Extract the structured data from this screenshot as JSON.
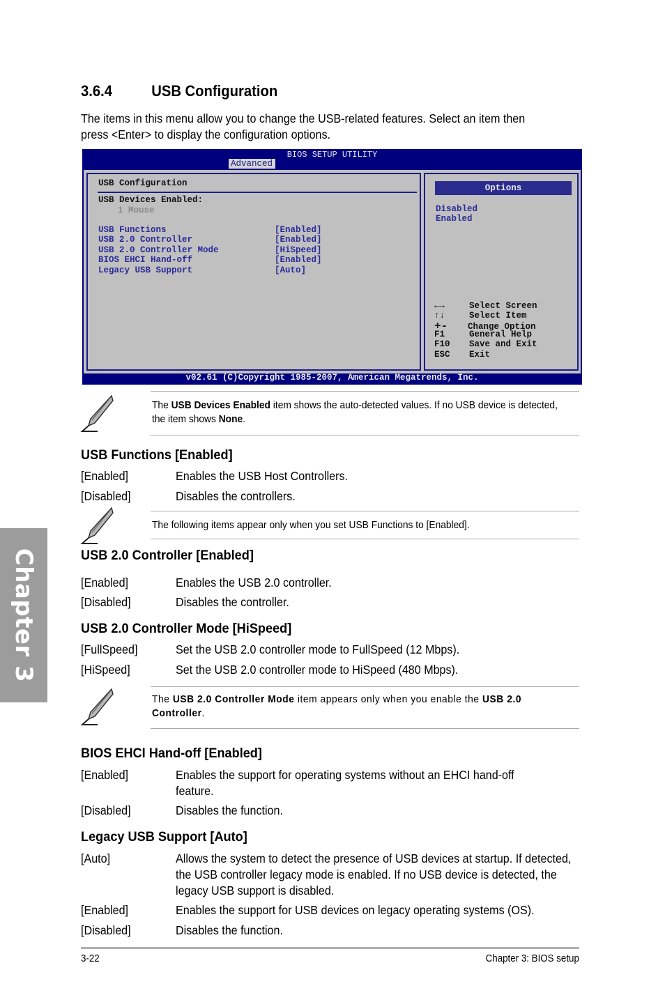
{
  "chapter_tab": "Chapter 3",
  "section": {
    "number": "3.6.4",
    "title": "USB Configuration"
  },
  "intro": [
    "The items in this menu allow you to change the USB-related features. Select an item then",
    "press <Enter> to display the configuration options."
  ],
  "bios": {
    "title": "BIOS SETUP UTILITY",
    "active_tab": "Advanced",
    "heading": "USB Configuration",
    "devices_label": "USB Devices Enabled:",
    "devices_value": "1 Mouse",
    "items": [
      {
        "label": "USB Functions",
        "value": "[Enabled]"
      },
      {
        "label": "USB 2.0 Controller",
        "value": "[Enabled]"
      },
      {
        "label": "USB 2.0 Controller Mode",
        "value": "[HiSpeed]"
      },
      {
        "label": "BIOS EHCI Hand-off",
        "value": "[Enabled]"
      },
      {
        "label": "Legacy USB Support",
        "value": "[Auto]"
      }
    ],
    "options_header": "Options",
    "options": [
      "Disabled",
      "Enabled"
    ],
    "keys": [
      {
        "key": "←→",
        "action": "Select Screen",
        "icon": "left-right-arrows-icon"
      },
      {
        "key": "↑↓",
        "action": "Select Item",
        "icon": "up-down-arrows-icon"
      },
      {
        "key": "+-",
        "action": "Change Option",
        "icon": "plus-minus-icon"
      },
      {
        "key": "F1",
        "action": "General Help"
      },
      {
        "key": "F10",
        "action": "Save and Exit"
      },
      {
        "key": "ESC",
        "action": "Exit"
      }
    ],
    "footer": "v02.61 (C)Copyright 1985-2007, American Megatrends, Inc."
  },
  "notes": {
    "devices": {
      "pre": "The ",
      "bold1": "USB Devices Enabled",
      "mid": " item shows the auto-detected values. If no USB device is detected, the item shows ",
      "bold2": "None",
      "post": "."
    },
    "following": "The following items appear only when you set USB Functions to [Enabled].",
    "mode": {
      "pre": "The ",
      "bold1": "USB 2.0 Controller Mode",
      "mid": " item appears only when you enable the ",
      "bold2": "USB 2.0 Controller",
      "post": "."
    }
  },
  "settings": [
    {
      "heading": "USB Functions [Enabled]",
      "options": [
        {
          "key": "[Enabled]",
          "desc": "Enables the USB Host Controllers."
        },
        {
          "key": "[Disabled]",
          "desc": "Disables the controllers."
        }
      ]
    },
    {
      "heading": "USB 2.0 Controller [Enabled]",
      "options": [
        {
          "key": "[Enabled]",
          "desc": "Enables the USB 2.0 controller."
        },
        {
          "key": "[Disabled]",
          "desc": "Disables the controller."
        }
      ]
    },
    {
      "heading": "USB 2.0 Controller Mode [HiSpeed]",
      "options": [
        {
          "key": "[FullSpeed]",
          "desc": "Set the USB 2.0 controller mode to FullSpeed (12 Mbps)."
        },
        {
          "key": "[HiSpeed]",
          "desc": "Set the USB 2.0 controller mode to HiSpeed (480 Mbps)."
        }
      ]
    },
    {
      "heading": "BIOS EHCI Hand-off [Enabled]",
      "options": [
        {
          "key": "[Enabled]",
          "desc": "Enables the support for operating systems without an EHCI hand-off feature."
        },
        {
          "key": "[Disabled]",
          "desc": "Disables the function."
        }
      ]
    },
    {
      "heading": "Legacy USB Support [Auto]",
      "options": [
        {
          "key": "[Auto]",
          "desc": "Allows the system to detect the presence of USB devices at startup. If detected, the USB controller legacy mode is enabled. If no USB device is detected, the legacy USB support is disabled."
        },
        {
          "key": "[Enabled]",
          "desc": "Enables the support for USB devices on legacy operating systems (OS)."
        },
        {
          "key": "[Disabled]",
          "desc": "Disables the function."
        }
      ]
    }
  ],
  "footer": {
    "page": "3-22",
    "chapter": "Chapter 3: BIOS setup"
  }
}
